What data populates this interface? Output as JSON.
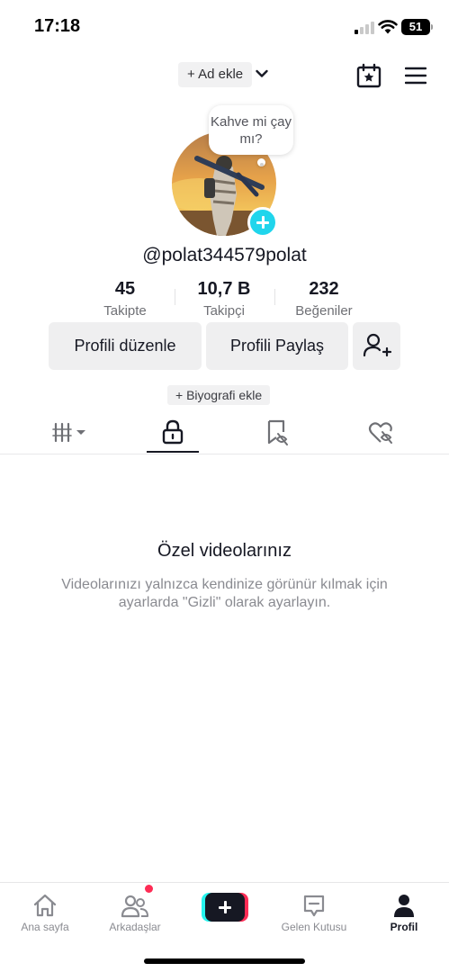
{
  "status_bar": {
    "time": "17:18",
    "battery": "51"
  },
  "header": {
    "add_name_label": "+ Ad ekle"
  },
  "profile": {
    "note": "Kahve mi çay mı?",
    "username": "@polat344579polat",
    "stats": [
      {
        "value": "45",
        "label": "Takipte"
      },
      {
        "value": "10,7 B",
        "label": "Takipçi"
      },
      {
        "value": "232",
        "label": "Beğeniler"
      }
    ],
    "buttons": {
      "edit_profile": "Profili düzenle",
      "share_profile": "Profili Paylaş"
    },
    "bio_label": "+ Biyografi ekle"
  },
  "tabs": {
    "items": [
      {
        "icon": "videos-grid-icon",
        "active": false
      },
      {
        "icon": "lock-icon",
        "active": true
      },
      {
        "icon": "saved-icon",
        "active": false
      },
      {
        "icon": "liked-icon",
        "active": false
      }
    ]
  },
  "empty_state": {
    "title": "Özel videolarınız",
    "description": "Videolarınızı yalnızca kendinize görünür kılmak için ayarlarda \"Gizli\" olarak ayarlayın."
  },
  "bottom_nav": {
    "items": [
      {
        "label": "Ana sayfa",
        "icon": "home-icon"
      },
      {
        "label": "Arkadaşlar",
        "icon": "friends-icon"
      },
      {
        "label": "",
        "icon": "create-icon"
      },
      {
        "label": "Gelen Kutusu",
        "icon": "inbox-icon"
      },
      {
        "label": "Profil",
        "icon": "profile-icon"
      }
    ]
  },
  "colors": {
    "accent_cyan": "#20d5ec",
    "accent_red": "#fe2c55",
    "text_primary": "#161823",
    "text_secondary": "#8a8b91"
  }
}
